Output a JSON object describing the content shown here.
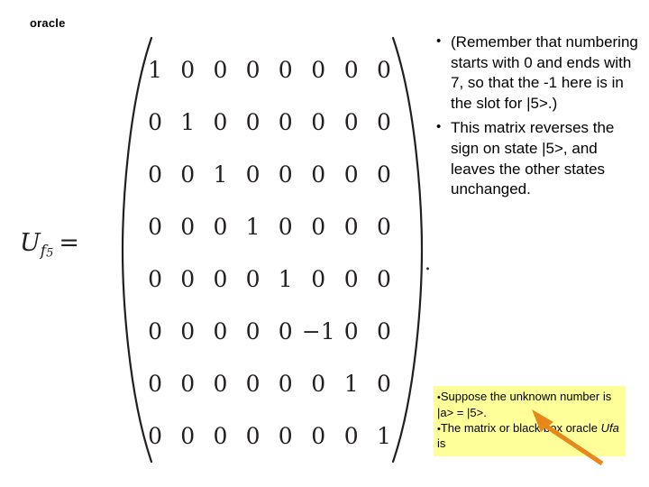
{
  "slide": {
    "title": "oracle",
    "equation": {
      "label_main": "U",
      "label_sub": "f",
      "label_sub2": "5",
      "label_equals": "=",
      "trailing_period": ".",
      "matrix_rows": [
        [
          "1",
          "0",
          "0",
          "0",
          "0",
          "0",
          "0",
          "0"
        ],
        [
          "0",
          "1",
          "0",
          "0",
          "0",
          "0",
          "0",
          "0"
        ],
        [
          "0",
          "0",
          "1",
          "0",
          "0",
          "0",
          "0",
          "0"
        ],
        [
          "0",
          "0",
          "0",
          "1",
          "0",
          "0",
          "0",
          "0"
        ],
        [
          "0",
          "0",
          "0",
          "0",
          "1",
          "0",
          "0",
          "0"
        ],
        [
          "0",
          "0",
          "0",
          "0",
          "0",
          "−1",
          "0",
          "0"
        ],
        [
          "0",
          "0",
          "0",
          "0",
          "0",
          "0",
          "1",
          "0"
        ],
        [
          "0",
          "0",
          "0",
          "0",
          "0",
          "0",
          "0",
          "1"
        ]
      ]
    },
    "bullets": [
      {
        "marker": "•",
        "text": "(Remember that numbering starts with 0 and ends with 7, so that the -1 here is in the slot for |5>.)"
      },
      {
        "marker": "•",
        "text": "This matrix reverses the sign on state |5>, and leaves the other states unchanged."
      }
    ],
    "callout": {
      "line1_marker": "•",
      "line1": "Suppose the unknown number is |a> = |5>.",
      "line2_marker": "•",
      "line2_a": "The matrix or black box oracle ",
      "line2_italic": "Ufa",
      "line2_b": " is",
      "background_color": "#ffff99"
    },
    "arrow": {
      "color": "#e8871a"
    }
  }
}
